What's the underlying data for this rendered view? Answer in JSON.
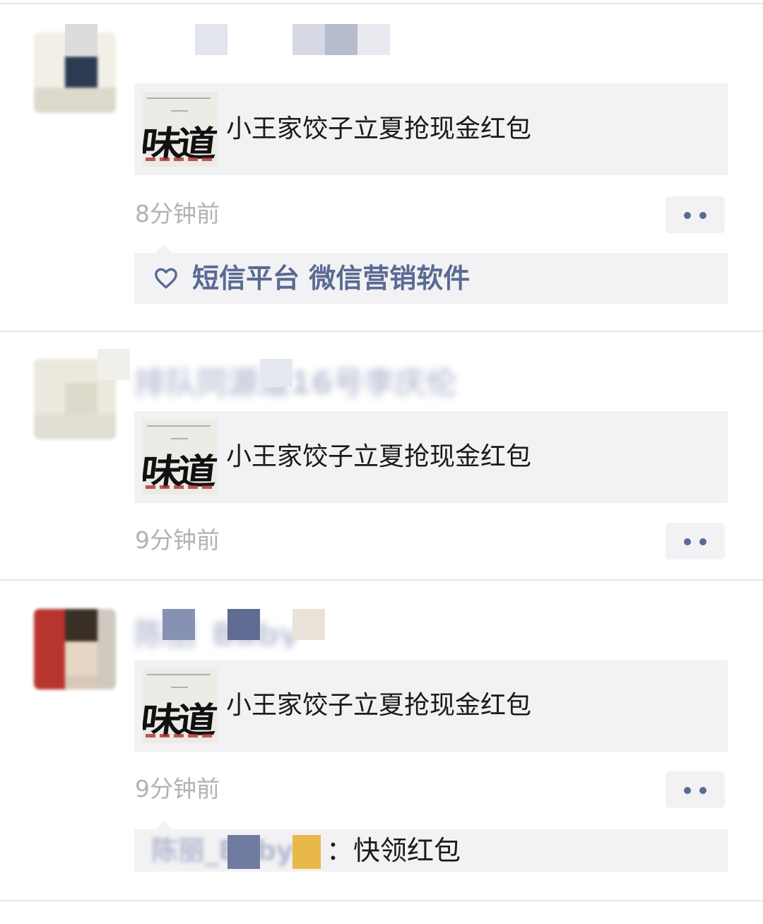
{
  "posts": [
    {
      "share_title": "小王家饺子立夏抢现金红包",
      "time": "8分钟前",
      "likes": "短信平台 微信营销软件"
    },
    {
      "author_blurred": "排队同源道16号李庆伦",
      "share_title": "小王家饺子立夏抢现金红包",
      "time": "9分钟前"
    },
    {
      "author_blurred": "陈丽_Baby",
      "share_title": "小王家饺子立夏抢现金红包",
      "time": "9分钟前",
      "comment": {
        "author_blurred": "陈丽_Baby",
        "text": "：快领红包"
      }
    }
  ],
  "thumbnail_glyph": "味道",
  "icons": {
    "more": "more-dots-icon",
    "like": "heart-icon"
  },
  "colors": {
    "link_blue": "#5a6a94",
    "card_bg": "#f2f2f4",
    "time_gray": "#b2b2b2"
  }
}
